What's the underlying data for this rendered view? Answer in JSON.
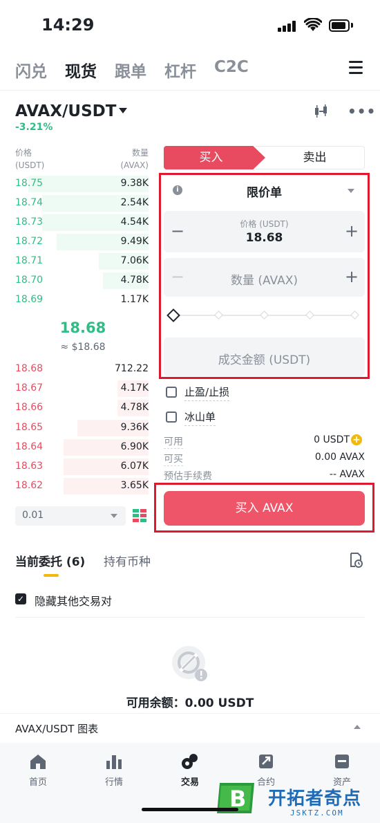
{
  "status_bar": {
    "time": "14:29"
  },
  "top_tabs": [
    {
      "label": "闪兑",
      "active": false
    },
    {
      "label": "现货",
      "active": true
    },
    {
      "label": "跟单",
      "active": false
    },
    {
      "label": "杠杆",
      "active": false
    },
    {
      "label": "C2C",
      "active": false
    }
  ],
  "pair": {
    "symbol": "AVAX/USDT",
    "change": "-3.21%"
  },
  "order_book": {
    "price_header": "价格",
    "price_unit": "(USDT)",
    "qty_header": "数量",
    "qty_unit": "(AVAX)",
    "bids": [
      {
        "price": "18.75",
        "qty": "9.38K",
        "depth": 0.85
      },
      {
        "price": "18.74",
        "qty": "2.54K",
        "depth": 0.75
      },
      {
        "price": "18.73",
        "qty": "4.54K",
        "depth": 0.75
      },
      {
        "price": "18.72",
        "qty": "9.49K",
        "depth": 0.65
      },
      {
        "price": "18.71",
        "qty": "7.06K",
        "depth": 0.35
      },
      {
        "price": "18.70",
        "qty": "4.78K",
        "depth": 0.32
      },
      {
        "price": "18.69",
        "qty": "1.17K",
        "depth": 0.0
      }
    ],
    "mid_price": "18.68",
    "mid_fiat": "≈ $18.68",
    "asks": [
      {
        "price": "18.68",
        "qty": "712.22",
        "depth": 0.0
      },
      {
        "price": "18.67",
        "qty": "4.17K",
        "depth": 0.22
      },
      {
        "price": "18.66",
        "qty": "4.78K",
        "depth": 0.22
      },
      {
        "price": "18.65",
        "qty": "9.36K",
        "depth": 0.5
      },
      {
        "price": "18.64",
        "qty": "6.90K",
        "depth": 0.6
      },
      {
        "price": "18.63",
        "qty": "6.07K",
        "depth": 0.6
      },
      {
        "price": "18.62",
        "qty": "3.65K",
        "depth": 0.6
      }
    ],
    "precision": "0.01"
  },
  "trade_form": {
    "buy_tab": "买入",
    "sell_tab": "卖出",
    "info_mark": "i",
    "order_type": "限价单",
    "price_label": "价格 (USDT)",
    "price_value": "18.68",
    "qty_placeholder": "数量 (AVAX)",
    "total_placeholder": "成交金额 (USDT)",
    "minus": "−",
    "plus": "+",
    "tp_sl": "止盈/止损",
    "iceberg": "冰山单",
    "available_label": "可用",
    "available_value": "0 USDT",
    "can_buy_label": "可买",
    "can_buy_value": "0.00 AVAX",
    "fee_label": "预估手续费",
    "fee_value": "-- AVAX",
    "buy_button": "买入 AVAX"
  },
  "orders": {
    "tab_open": "当前委托 (6)",
    "tab_holdings": "持有币种",
    "hide_other": "隐藏其他交易对",
    "check_mark": "✓",
    "available_balance": "可用余额：0.00 USDT",
    "chart_label": "AVAX/USDT 图表"
  },
  "bottom_nav": [
    {
      "label": "首页",
      "icon": "home-icon",
      "active": false
    },
    {
      "label": "行情",
      "icon": "market-icon",
      "active": false
    },
    {
      "label": "交易",
      "icon": "trade-icon",
      "active": true
    },
    {
      "label": "合约",
      "icon": "futures-icon",
      "active": false
    },
    {
      "label": "资产",
      "icon": "wallet-icon",
      "active": false
    }
  ],
  "watermark": {
    "text": "开拓者奇点",
    "sub": "JSKTZ.COM",
    "logo_letter": "B"
  },
  "colors": {
    "buy": "#e84a5f",
    "bid": "#2ebd85",
    "accent": "#f0b90b",
    "highlight_box": "#e0182e"
  }
}
